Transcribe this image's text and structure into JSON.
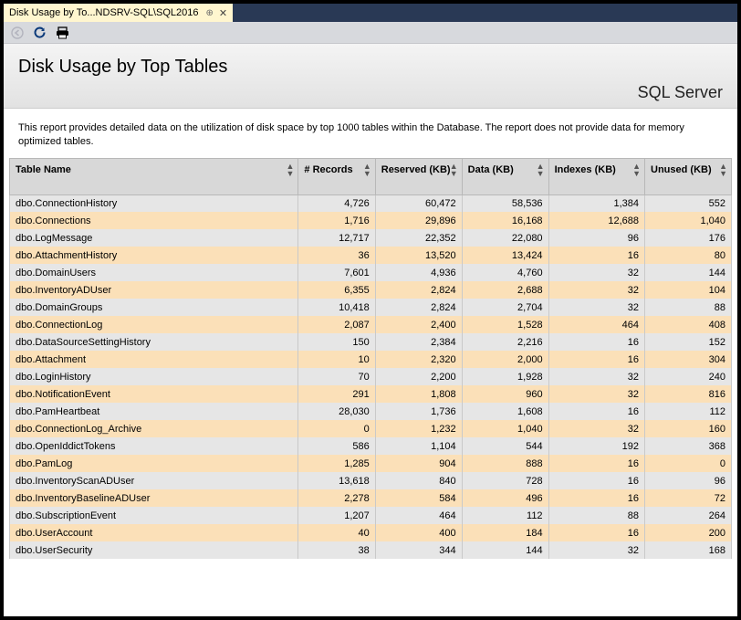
{
  "tab": {
    "title": "Disk Usage by To...NDSRV-SQL\\SQL2016"
  },
  "report": {
    "title": "Disk Usage by Top Tables",
    "subtitle": "SQL Server",
    "description": "This report provides detailed data on the utilization of disk space by top 1000 tables within the Database. The report does not provide data for memory optimized tables."
  },
  "columns": [
    {
      "label": "Table Name"
    },
    {
      "label": "# Records"
    },
    {
      "label": "Reserved (KB)"
    },
    {
      "label": "Data (KB)"
    },
    {
      "label": "Indexes (KB)"
    },
    {
      "label": "Unused (KB)"
    }
  ],
  "chart_data": {
    "type": "table",
    "columns": [
      "Table Name",
      "# Records",
      "Reserved (KB)",
      "Data (KB)",
      "Indexes (KB)",
      "Unused (KB)"
    ],
    "rows": [
      [
        "dbo.ConnectionHistory",
        4726,
        60472,
        58536,
        1384,
        552
      ],
      [
        "dbo.Connections",
        1716,
        29896,
        16168,
        12688,
        1040
      ],
      [
        "dbo.LogMessage",
        12717,
        22352,
        22080,
        96,
        176
      ],
      [
        "dbo.AttachmentHistory",
        36,
        13520,
        13424,
        16,
        80
      ],
      [
        "dbo.DomainUsers",
        7601,
        4936,
        4760,
        32,
        144
      ],
      [
        "dbo.InventoryADUser",
        6355,
        2824,
        2688,
        32,
        104
      ],
      [
        "dbo.DomainGroups",
        10418,
        2824,
        2704,
        32,
        88
      ],
      [
        "dbo.ConnectionLog",
        2087,
        2400,
        1528,
        464,
        408
      ],
      [
        "dbo.DataSourceSettingHistory",
        150,
        2384,
        2216,
        16,
        152
      ],
      [
        "dbo.Attachment",
        10,
        2320,
        2000,
        16,
        304
      ],
      [
        "dbo.LoginHistory",
        70,
        2200,
        1928,
        32,
        240
      ],
      [
        "dbo.NotificationEvent",
        291,
        1808,
        960,
        32,
        816
      ],
      [
        "dbo.PamHeartbeat",
        28030,
        1736,
        1608,
        16,
        112
      ],
      [
        "dbo.ConnectionLog_Archive",
        0,
        1232,
        1040,
        32,
        160
      ],
      [
        "dbo.OpenIddictTokens",
        586,
        1104,
        544,
        192,
        368
      ],
      [
        "dbo.PamLog",
        1285,
        904,
        888,
        16,
        0
      ],
      [
        "dbo.InventoryScanADUser",
        13618,
        840,
        728,
        16,
        96
      ],
      [
        "dbo.InventoryBaselineADUser",
        2278,
        584,
        496,
        16,
        72
      ],
      [
        "dbo.SubscriptionEvent",
        1207,
        464,
        112,
        88,
        264
      ],
      [
        "dbo.UserAccount",
        40,
        400,
        184,
        16,
        200
      ],
      [
        "dbo.UserSecurity",
        38,
        344,
        144,
        32,
        168
      ]
    ]
  }
}
